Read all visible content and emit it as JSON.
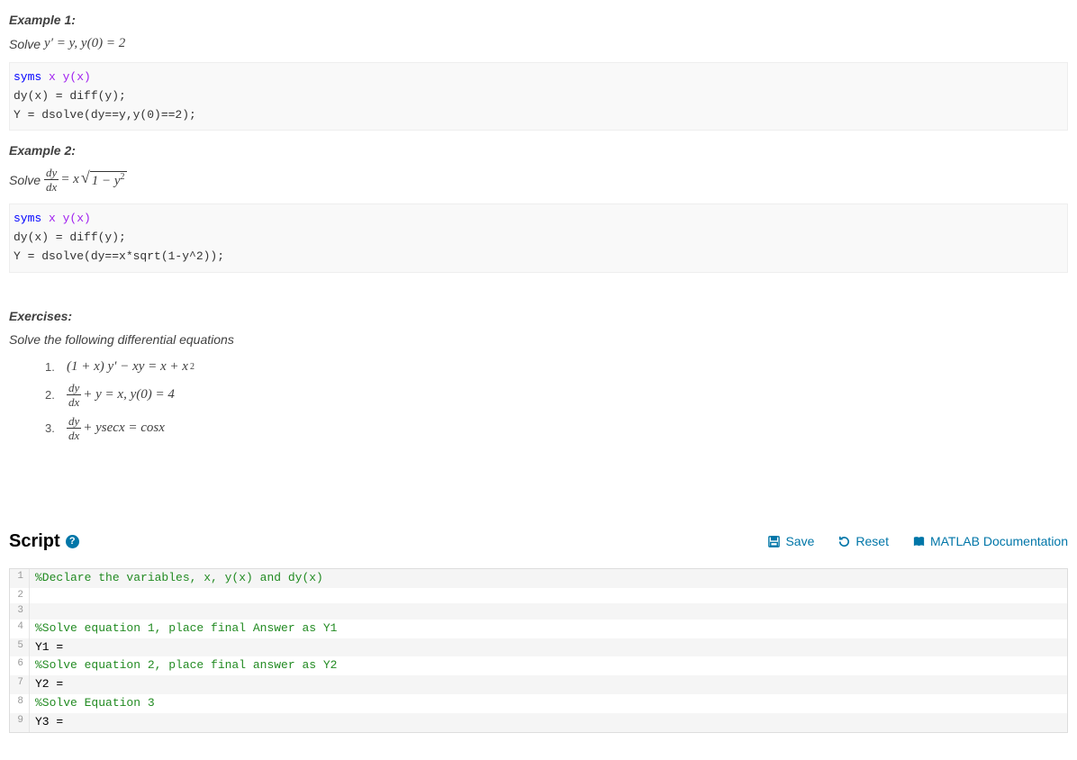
{
  "example1": {
    "title": "Example 1:",
    "solve_label": "Solve",
    "equation_text": "y′ = y, y(0) = 2",
    "code_syms_kw": "syms",
    "code_syms_args": " x y(x)",
    "code_line2": "dy(x) = diff(y);",
    "code_line3": "Y = dsolve(dy==y,y(0)==2);"
  },
  "example2": {
    "title": "Example 2:",
    "solve_label": "Solve",
    "frac_num": "dy",
    "frac_den": "dx",
    "eq_mid": " = x ",
    "sqrt_body": "1 − y",
    "sqrt_exp": "2",
    "code_syms_kw": "syms",
    "code_syms_args": " x y(x)",
    "code_line2": "dy(x) = diff(y);",
    "code_line3": "Y = dsolve(dy==x*sqrt(1-y^2));"
  },
  "exercises": {
    "title": "Exercises:",
    "subtitle": "Solve the following differential equations",
    "items": [
      {
        "num": "1.",
        "text": "(1 + x) y′ − xy = x + x",
        "sup": "2"
      },
      {
        "num": "2.",
        "frac_num": "dy",
        "frac_den": "dx",
        "rest": " + y = x, y(0) = 4"
      },
      {
        "num": "3.",
        "frac_num": "dy",
        "frac_den": "dx",
        "rest": " + ysecx = cosx"
      }
    ]
  },
  "script": {
    "title": "Script",
    "actions": {
      "save": "Save",
      "reset": "Reset",
      "docs": "MATLAB Documentation"
    },
    "lines": [
      {
        "n": "1",
        "type": "comment",
        "text": "%Declare the variables, x, y(x) and dy(x)"
      },
      {
        "n": "2",
        "type": "code",
        "text": ""
      },
      {
        "n": "3",
        "type": "code",
        "text": ""
      },
      {
        "n": "4",
        "type": "comment",
        "text": "%Solve equation 1, place final Answer as Y1"
      },
      {
        "n": "5",
        "type": "code",
        "text": "Y1 ="
      },
      {
        "n": "6",
        "type": "comment",
        "text": "%Solve equation 2, place final answer as Y2"
      },
      {
        "n": "7",
        "type": "code",
        "text": "Y2 ="
      },
      {
        "n": "8",
        "type": "comment",
        "text": "%Solve Equation 3"
      },
      {
        "n": "9",
        "type": "code",
        "text": "Y3 ="
      }
    ]
  }
}
